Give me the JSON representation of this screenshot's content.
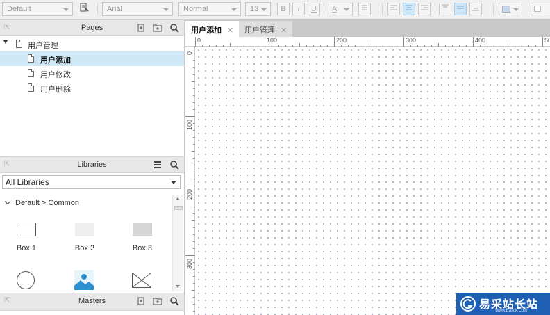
{
  "toolbar": {
    "style_select": "Default",
    "font_select": "Arial",
    "weight_select": "Normal",
    "size_select": "13",
    "bold": "B",
    "italic": "I",
    "underline": "U",
    "font_color": "A"
  },
  "pages": {
    "title": "Pages",
    "items": [
      {
        "label": "用户管理"
      },
      {
        "label": "用户添加"
      },
      {
        "label": "用户修改"
      },
      {
        "label": "用户删除"
      }
    ]
  },
  "libraries": {
    "title": "Libraries",
    "selected": "All Libraries",
    "group": "Default > Common",
    "items": [
      {
        "label": "Box 1"
      },
      {
        "label": "Box 2"
      },
      {
        "label": "Box 3"
      }
    ]
  },
  "masters": {
    "title": "Masters"
  },
  "tabs": [
    {
      "label": "用户添加"
    },
    {
      "label": "用户管理"
    }
  ],
  "ruler": {
    "top": [
      "0",
      "100",
      "200",
      "300",
      "400",
      "50"
    ],
    "left": [
      "0",
      "100",
      "200",
      "300"
    ]
  },
  "watermark": {
    "name": "易采站长站",
    "url": "Www.Easck.Com"
  },
  "colors": {
    "accent": "#cfe8f6",
    "panel_header": "#e8e8e8",
    "watermark": "#1e5fb3"
  }
}
